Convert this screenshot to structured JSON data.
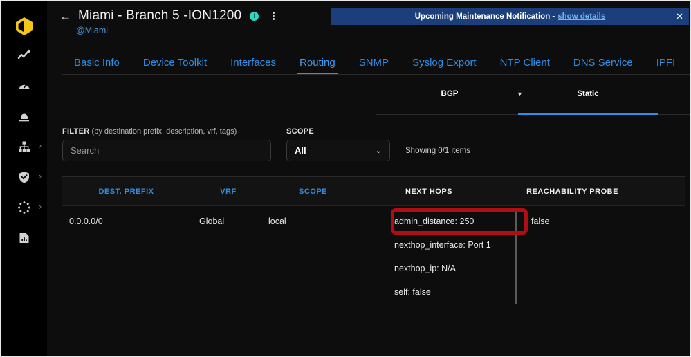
{
  "brand": {
    "logo_icon": "hexagon-logo-icon",
    "logo_color": "#f5c518"
  },
  "sidebar": {
    "items": [
      {
        "icon": "activity-trend-icon",
        "name": "sidebar-item-activity",
        "expandable": false
      },
      {
        "icon": "gauge-icon",
        "name": "sidebar-item-dashboard",
        "expandable": false
      },
      {
        "icon": "device-stack-icon",
        "name": "sidebar-item-devices",
        "expandable": false
      },
      {
        "icon": "network-topology-icon",
        "name": "sidebar-item-network",
        "expandable": true
      },
      {
        "icon": "shield-check-icon",
        "name": "sidebar-item-policies",
        "expandable": true
      },
      {
        "icon": "dotted-circle-icon",
        "name": "sidebar-item-system",
        "expandable": true
      },
      {
        "icon": "report-chart-icon",
        "name": "sidebar-item-reports",
        "expandable": false
      }
    ],
    "chevron_glyph": "›"
  },
  "header": {
    "back_arrow": "←",
    "title": "Miami - Branch 5 -ION1200",
    "subtitle": "@Miami",
    "info_badge": "!",
    "kebab_icon": "more-vertical-icon"
  },
  "banner": {
    "text": "Upcoming Maintenance Notification - ",
    "link": "show details",
    "close": "✕",
    "background": "#1c3f7c"
  },
  "tabs": {
    "items": [
      {
        "label": "Basic Info",
        "active": false
      },
      {
        "label": "Device Toolkit",
        "active": false
      },
      {
        "label": "Interfaces",
        "active": false
      },
      {
        "label": "Routing",
        "active": true
      },
      {
        "label": "SNMP",
        "active": false
      },
      {
        "label": "Syslog Export",
        "active": false
      },
      {
        "label": "NTP Client",
        "active": false
      },
      {
        "label": "DNS Service",
        "active": false
      },
      {
        "label": "IPFI",
        "active": false
      }
    ],
    "accent": "#2f8fe8"
  },
  "subtabs": {
    "bgp_label": "BGP",
    "bgp_caret": "▼",
    "static_label": "Static",
    "active": "Static"
  },
  "filter": {
    "label_bold": "FILTER",
    "label_hint": " (by destination prefix, description, vrf, tags)",
    "placeholder": "Search",
    "value": ""
  },
  "scope": {
    "label": "SCOPE",
    "value": "All",
    "caret": "⌄"
  },
  "showing": {
    "text": "Showing 0/1 items"
  },
  "table": {
    "columns": [
      {
        "label": "DEST. PREFIX",
        "sortable": true
      },
      {
        "label": "VRF",
        "sortable": true
      },
      {
        "label": "SCOPE",
        "sortable": true
      },
      {
        "label": "NEXT HOPS",
        "sortable": false
      },
      {
        "label": "REACHABILITY PROBE",
        "sortable": false
      }
    ],
    "rows": [
      {
        "dest_prefix": "0.0.0.0/0",
        "vrf": "Global",
        "scope": "local",
        "next_hops": [
          "admin_distance: 250",
          "nexthop_interface: Port 1",
          "nexthop_ip: N/A",
          "self: false"
        ],
        "reachability_probe": "false"
      }
    ]
  },
  "annotation": {
    "type": "red-rectangle-highlight",
    "target": "admin_distance: 250",
    "color": "#ad0f12"
  }
}
